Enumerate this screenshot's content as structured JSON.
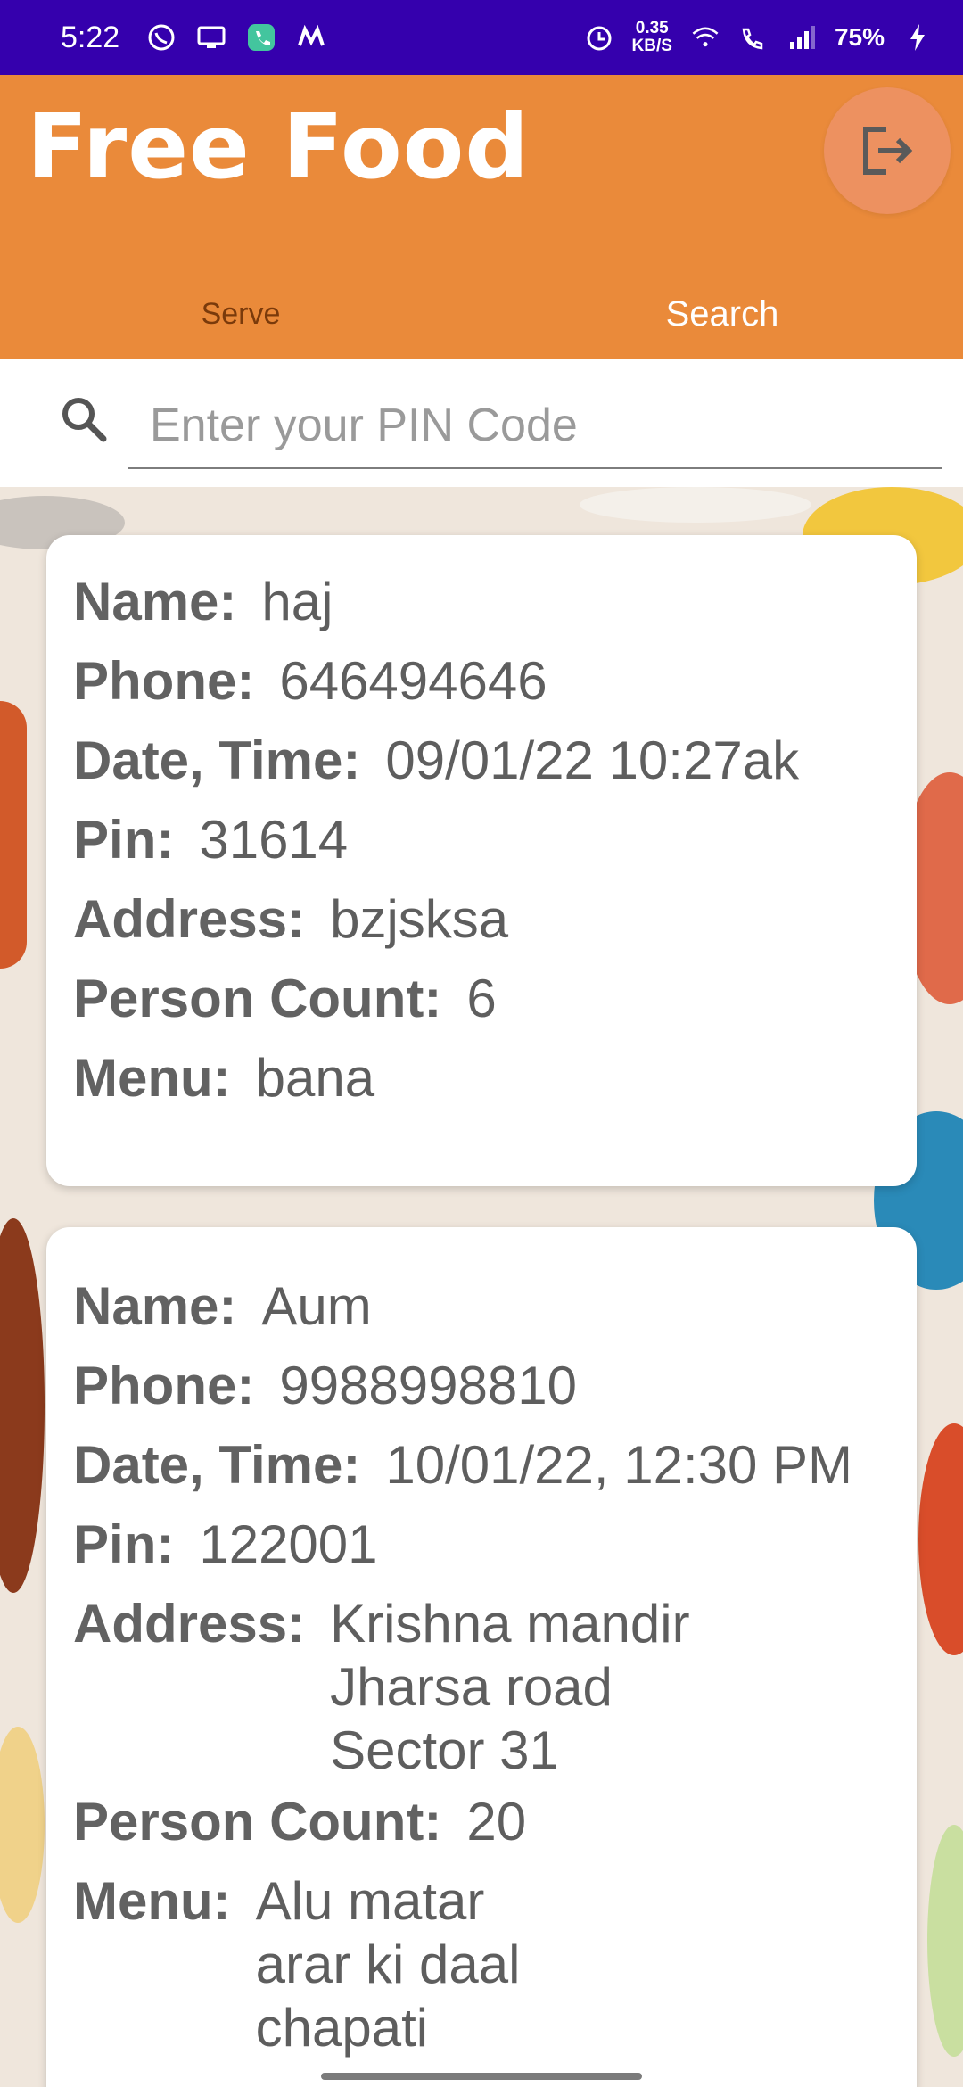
{
  "status_bar": {
    "time": "5:22",
    "net_speed_value": "0.35",
    "net_speed_unit": "KB/S",
    "battery": "75%"
  },
  "app": {
    "title": "Free Food",
    "tabs": [
      {
        "label": "Serve",
        "active": false
      },
      {
        "label": "Search",
        "active": true
      }
    ],
    "colors": {
      "accent": "#ea8a3a",
      "status_bar": "#3500ad"
    }
  },
  "search": {
    "placeholder": "Enter your PIN Code",
    "value": ""
  },
  "labels": {
    "name": "Name:",
    "phone": "Phone:",
    "datetime": "Date, Time:",
    "pin": "Pin:",
    "address": "Address:",
    "person_count": "Person Count:",
    "menu": "Menu:"
  },
  "entries": [
    {
      "name": "haj",
      "phone": "646494646",
      "datetime": "09/01/22 10:27ak",
      "pin": "31614",
      "address": "bzjsksa",
      "person_count": "6",
      "menu": "bana"
    },
    {
      "name": "Aum",
      "phone": "9988998810",
      "datetime": "10/01/22, 12:30 PM",
      "pin": "122001",
      "address": "Krishna mandir\nJharsa road\nSector 31",
      "person_count": "20",
      "menu": "Alu matar\narar ki daal\nchapati"
    }
  ]
}
